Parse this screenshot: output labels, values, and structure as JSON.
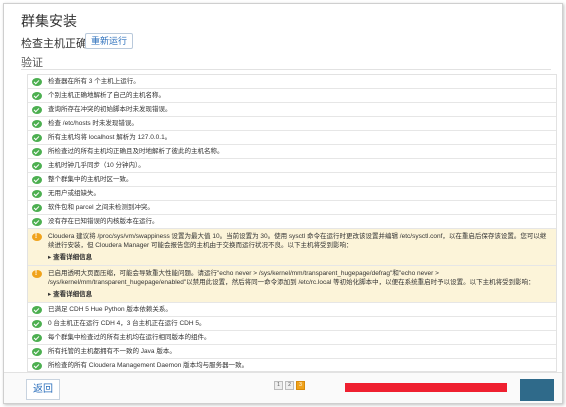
{
  "header": {
    "title": "群集安装",
    "subtitle": "检查主机正确性",
    "rerun_label": "重新运行",
    "section_label": "验证"
  },
  "checks": [
    {
      "status": "ok",
      "text": "检查器在所有 3 个主机上运行。"
    },
    {
      "status": "ok",
      "text": "个别主机正确地解析了自己的主机名称。"
    },
    {
      "status": "ok",
      "text": "查询所存在冲突的初始脚本时未发现错误。"
    },
    {
      "status": "ok",
      "text": "检查 /etc/hosts 时未发现错误。"
    },
    {
      "status": "ok",
      "text": "所有主机均将 localhost 解析为 127.0.0.1。"
    },
    {
      "status": "ok",
      "text": "所检查过的所有主机均正确且及时地解析了彼此的主机名称。"
    },
    {
      "status": "ok",
      "text": "主机时钟几乎同步（10 分钟内）。"
    },
    {
      "status": "ok",
      "text": "整个群集中的主机时区一致。"
    },
    {
      "status": "ok",
      "text": "无用户或组缺失。"
    },
    {
      "status": "ok",
      "text": "软件包和 parcel 之间未检测到冲突。"
    },
    {
      "status": "ok",
      "text": "没有存在已知错误的内核版本在运行。"
    },
    {
      "status": "warn",
      "text": "Cloudera 建议将 /proc/sys/vm/swappiness 设置为最大值 10。当前设置为 30。使用 sysctl 命令在运行时更改该设置并编辑 /etc/sysctl.conf，以在重启后保存该设置。您可以继续进行安装，但 Cloudera Manager 可能会报告您的主机由于交换而运行状况不良。以下主机将受到影响：",
      "more": "查看详细信息"
    },
    {
      "status": "warn",
      "text": "已启用透明大页面压缩，可能会导致重大性能问题。请运行\"echo never > /sys/kernel/mm/transparent_hugepage/defrag\"和\"echo never > /sys/kernel/mm/transparent_hugepage/enabled\"以禁用此设置，然后将同一命令添加到 /etc/rc.local 等初始化脚本中，以便在系统重启时予以设置。以下主机将受到影响：",
      "more": "查看详细信息"
    },
    {
      "status": "ok",
      "text": "已满足 CDH 5 Hue Python 版本依赖关系。"
    },
    {
      "status": "ok",
      "text": "0 台主机正在运行 CDH 4，3 台主机正在运行 CDH 5。"
    },
    {
      "status": "ok",
      "text": "每个群集中检查过的所有主机均在运行相同版本的组件。"
    },
    {
      "status": "ok",
      "text": "所有托管的主机都拥有不一致的 Java 版本。"
    },
    {
      "status": "ok",
      "text": "所检查的所有 Cloudera Management Daemon 版本均与服务器一致。"
    }
  ],
  "footer": {
    "back_label": "返回",
    "pages": [
      "1",
      "2",
      "3"
    ],
    "active_page": 3
  },
  "colors": {
    "ok": "#4caf50",
    "warn": "#f0a31c",
    "warn_bg": "#fcf4d9",
    "link": "#2a6ebb",
    "continue_button": "#2f6a8a",
    "redaction": "#ef2030"
  }
}
